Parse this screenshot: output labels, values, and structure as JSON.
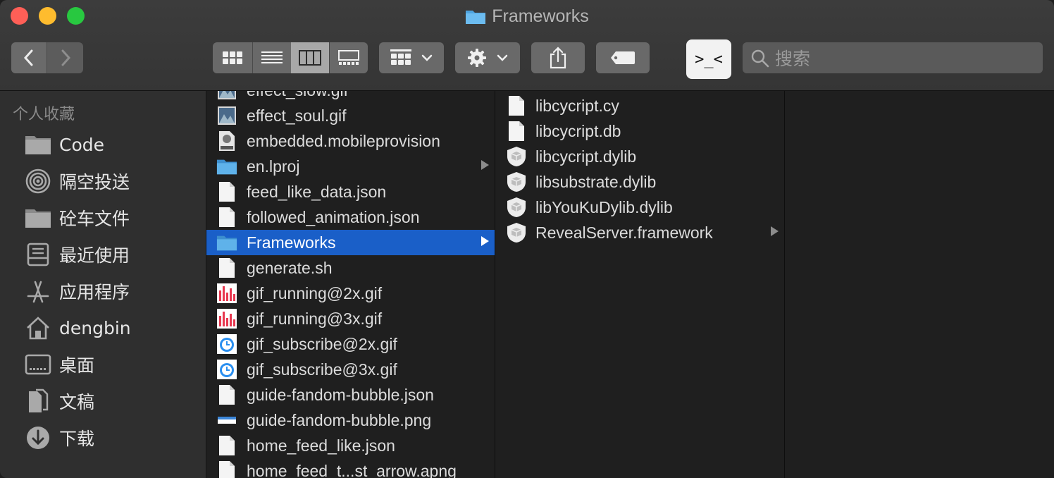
{
  "window": {
    "title": "Frameworks"
  },
  "toolbar": {
    "search_placeholder": "搜索",
    "terminal_label": ">_<"
  },
  "sidebar": {
    "section_title": "个人收藏",
    "items": [
      {
        "label": "Code",
        "icon": "folder-icon"
      },
      {
        "label": "隔空投送",
        "icon": "airdrop-icon"
      },
      {
        "label": "砼车文件",
        "icon": "folder-icon"
      },
      {
        "label": "最近使用",
        "icon": "recents-icon"
      },
      {
        "label": "应用程序",
        "icon": "applications-icon"
      },
      {
        "label": "dengbin",
        "icon": "home-icon"
      },
      {
        "label": "桌面",
        "icon": "desktop-icon"
      },
      {
        "label": "文稿",
        "icon": "documents-icon"
      },
      {
        "label": "下载",
        "icon": "downloads-icon"
      }
    ]
  },
  "column1": {
    "items": [
      {
        "name": "effect_slow.gif",
        "icon": "image-thumb-icon",
        "folder": false
      },
      {
        "name": "effect_soul.gif",
        "icon": "image-thumb-icon",
        "folder": false
      },
      {
        "name": "embedded.mobileprovision",
        "icon": "provision-icon",
        "folder": false
      },
      {
        "name": "en.lproj",
        "icon": "folder-icon",
        "folder": true
      },
      {
        "name": "feed_like_data.json",
        "icon": "document-icon",
        "folder": false
      },
      {
        "name": "followed_animation.json",
        "icon": "document-icon",
        "folder": false
      },
      {
        "name": "Frameworks",
        "icon": "folder-icon",
        "folder": true,
        "selected": true
      },
      {
        "name": "generate.sh",
        "icon": "document-icon",
        "folder": false
      },
      {
        "name": "gif_running@2x.gif",
        "icon": "bars-gif-icon",
        "folder": false
      },
      {
        "name": "gif_running@3x.gif",
        "icon": "bars-gif-icon",
        "folder": false
      },
      {
        "name": "gif_subscribe@2x.gif",
        "icon": "alarm-gif-icon",
        "folder": false
      },
      {
        "name": "gif_subscribe@3x.gif",
        "icon": "alarm-gif-icon",
        "folder": false
      },
      {
        "name": "guide-fandom-bubble.json",
        "icon": "document-icon",
        "folder": false
      },
      {
        "name": "guide-fandom-bubble.png",
        "icon": "png-thumb-icon",
        "folder": false
      },
      {
        "name": "home_feed_like.json",
        "icon": "document-icon",
        "folder": false
      },
      {
        "name": "home_feed_t...st_arrow.apng",
        "icon": "document-icon",
        "folder": false
      }
    ]
  },
  "column2": {
    "items": [
      {
        "name": "libcycript.cy",
        "icon": "document-icon",
        "folder": false
      },
      {
        "name": "libcycript.db",
        "icon": "document-icon",
        "folder": false
      },
      {
        "name": "libcycript.dylib",
        "icon": "dylib-icon",
        "folder": false
      },
      {
        "name": "libsubstrate.dylib",
        "icon": "dylib-icon",
        "folder": false
      },
      {
        "name": "libYouKuDylib.dylib",
        "icon": "dylib-icon",
        "folder": false
      },
      {
        "name": "RevealServer.framework",
        "icon": "dylib-icon",
        "folder": true
      }
    ]
  }
}
